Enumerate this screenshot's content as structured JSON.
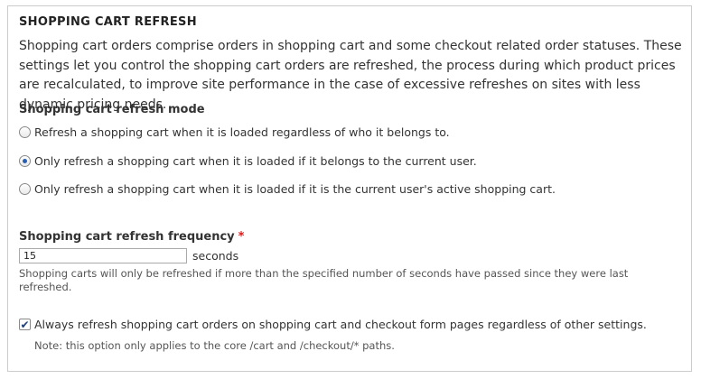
{
  "legend": "SHOPPING CART REFRESH",
  "description": "Shopping cart orders comprise orders in shopping cart and some checkout related order statuses. These settings let you control the shopping cart orders are refreshed, the process during which product prices are recalculated, to improve site performance in the case of excessive refreshes on sites with less dynamic pricing needs.",
  "mode": {
    "label": "Shopping cart refresh mode",
    "options": [
      {
        "label": "Refresh a shopping cart when it is loaded regardless of who it belongs to.",
        "selected": false
      },
      {
        "label": "Only refresh a shopping cart when it is loaded if it belongs to the current user.",
        "selected": true
      },
      {
        "label": "Only refresh a shopping cart when it is loaded if it is the current user's active shopping cart.",
        "selected": false
      }
    ]
  },
  "frequency": {
    "label": "Shopping cart refresh frequency",
    "required_mark": "*",
    "value": "15",
    "suffix": "seconds",
    "help": "Shopping carts will only be refreshed if more than the specified number of seconds have passed since they were last refreshed."
  },
  "always_refresh": {
    "label": "Always refresh shopping cart orders on shopping cart and checkout form pages regardless of other settings.",
    "checked": true,
    "note": "Note: this option only applies to the core /cart and /checkout/* paths."
  }
}
